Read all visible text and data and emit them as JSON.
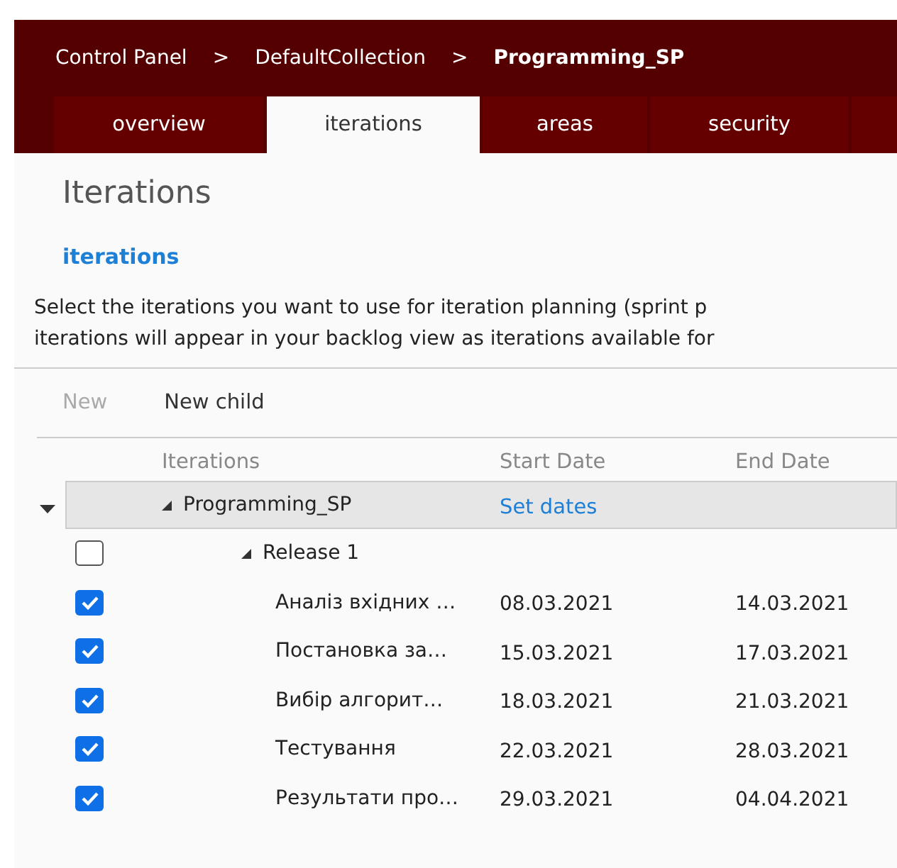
{
  "breadcrumb": [
    {
      "label": "Control Panel",
      "kind": "link",
      "current": false
    },
    {
      "label": ">",
      "kind": "separator"
    },
    {
      "label": "DefaultCollection",
      "kind": "link",
      "current": false
    },
    {
      "label": ">",
      "kind": "separator"
    },
    {
      "label": "Programming_SP",
      "kind": "link",
      "current": true
    }
  ],
  "tabs": [
    {
      "label": "overview",
      "selected": false
    },
    {
      "label": "iterations",
      "selected": true
    },
    {
      "label": "areas",
      "selected": false
    },
    {
      "label": "security",
      "selected": false
    }
  ],
  "page_title": "Iterations",
  "section_title": "iterations",
  "description": "Select the iterations you want to use for iteration planning (sprint p\niterations will appear in your backlog view as iterations available for",
  "toolbar": [
    {
      "label": "New",
      "disabled": true
    },
    {
      "label": "New child",
      "disabled": false
    }
  ],
  "table": {
    "columns": [
      "Iterations",
      "Start Date",
      "End Date"
    ],
    "rows": [
      {
        "name": "Programming_SP",
        "start_link": "Set dates",
        "expanded": true,
        "selected": true,
        "children": [
          {
            "name": "Release 1",
            "checked": false,
            "expanded": true,
            "selected": false,
            "children": [
              {
                "name": "Аналіз вхідних …",
                "start": "08.03.2021",
                "end": "14.03.2021",
                "checked": true,
                "selected": false
              },
              {
                "name": "Постановка за…",
                "start": "15.03.2021",
                "end": "17.03.2021",
                "checked": true,
                "selected": false
              },
              {
                "name": "Вибір алгорит…",
                "start": "18.03.2021",
                "end": "21.03.2021",
                "checked": true,
                "selected": false
              },
              {
                "name": "Тестування",
                "start": "22.03.2021",
                "end": "28.03.2021",
                "checked": true,
                "selected": false
              },
              {
                "name": "Результати про…",
                "start": "29.03.2021",
                "end": "04.04.2021",
                "checked": true,
                "selected": false
              }
            ]
          }
        ]
      }
    ]
  }
}
